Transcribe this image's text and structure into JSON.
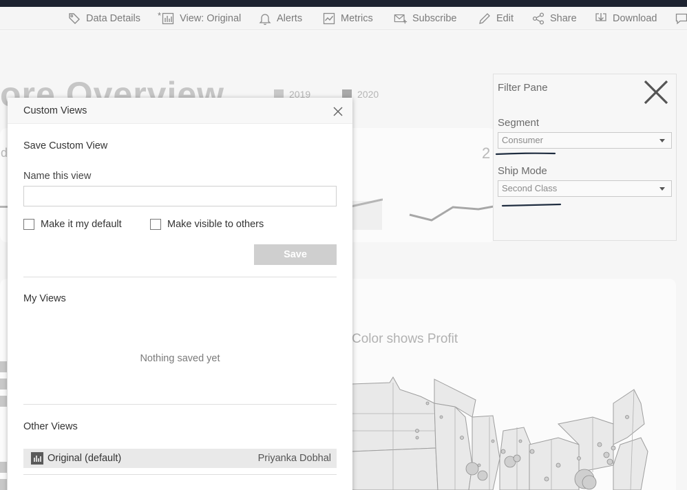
{
  "toolbar": {
    "items": [
      {
        "label": "Data Details",
        "icon": "tag-icon"
      },
      {
        "label": "View: Original",
        "icon": "view-chart-icon",
        "modified_marker": "*"
      },
      {
        "label": "Alerts",
        "icon": "bell-icon"
      },
      {
        "label": "Metrics",
        "icon": "metrics-icon"
      },
      {
        "label": "Subscribe",
        "icon": "mail-plus-icon"
      },
      {
        "label": "Edit",
        "icon": "pencil-icon"
      },
      {
        "label": "Share",
        "icon": "share-icon"
      },
      {
        "label": "Download",
        "icon": "download-icon"
      }
    ]
  },
  "dashboard": {
    "title_fragment": "ore Overview",
    "legend": [
      {
        "label": "2019",
        "color": "#c8c8c8"
      },
      {
        "label": "2020",
        "color": "#a9a9a9"
      }
    ],
    "kpi_fragment": "2",
    "left_fragment": "d",
    "map_caption": "Color shows Profit"
  },
  "filter_pane": {
    "title": "Filter Pane",
    "filters": [
      {
        "label": "Segment",
        "value": "Consumer"
      },
      {
        "label": "Ship Mode",
        "value": "Second Class"
      }
    ]
  },
  "dialog": {
    "title": "Custom Views",
    "save_section": {
      "heading": "Save Custom View",
      "name_label": "Name this view",
      "name_value": "",
      "default_checkbox": "Make it my default",
      "visible_checkbox": "Make visible to others",
      "save_button": "Save"
    },
    "my_views": {
      "heading": "My Views",
      "empty_text": "Nothing saved yet"
    },
    "other_views": {
      "heading": "Other Views",
      "items": [
        {
          "name": "Original (default)",
          "owner": "Priyanka Dobhal"
        }
      ]
    }
  }
}
